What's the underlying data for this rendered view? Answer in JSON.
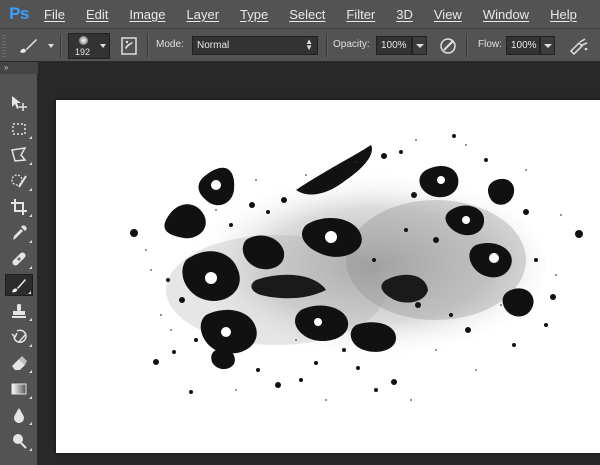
{
  "app": {
    "logo_text": "Ps"
  },
  "menu": {
    "items": [
      "File",
      "Edit",
      "Image",
      "Layer",
      "Type",
      "Select",
      "Filter",
      "3D",
      "View",
      "Window",
      "Help"
    ]
  },
  "options": {
    "brush_size": "192",
    "mode_label": "Mode:",
    "mode_value": "Normal",
    "opacity_label": "Opacity:",
    "opacity_value": "100%",
    "flow_label": "Flow:",
    "flow_value": "100%"
  },
  "toolbar": {
    "active_tool": "brush-tool",
    "tools": [
      "move-tool",
      "marquee-tool",
      "lasso-tool",
      "quick-selection-tool",
      "crop-tool",
      "eyedropper-tool",
      "healing-brush-tool",
      "brush-tool",
      "clone-stamp-tool",
      "history-brush-tool",
      "eraser-tool",
      "gradient-tool",
      "blur-tool",
      "dodge-tool"
    ]
  },
  "colors": {
    "ui_dark": "#282828",
    "ui_panel": "#535353",
    "field_bg": "#333333",
    "ps_blue": "#3aa0ff",
    "canvas_white": "#ffffff",
    "ink": "#111111"
  }
}
